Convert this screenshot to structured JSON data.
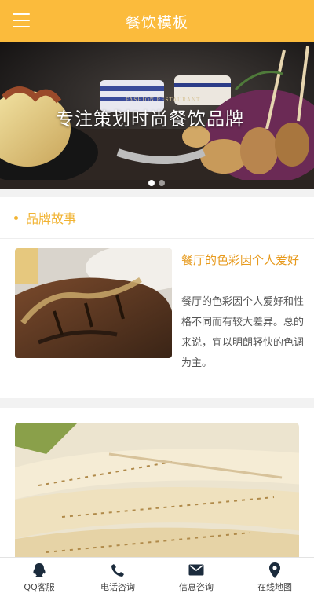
{
  "header": {
    "title": "餐饮模板",
    "menu_icon": "menu-icon"
  },
  "banner": {
    "headline": "专注策划时尚餐饮品牌",
    "subtext": "FASHION RESTAURANT",
    "slide_count": 2,
    "active_slide": 1
  },
  "section": {
    "title": "品牌故事"
  },
  "article": {
    "title": "餐厅的色彩因个人爱好",
    "desc": "餐厅的色彩因个人爱好和性格不同而有较大差异。总的来说，宜以明朗轻快的色调为主。"
  },
  "footer": {
    "items": [
      {
        "label": "QQ客服",
        "icon": "qq-icon"
      },
      {
        "label": "电话咨询",
        "icon": "phone-icon"
      },
      {
        "label": "信息咨询",
        "icon": "mail-icon"
      },
      {
        "label": "在线地图",
        "icon": "map-pin-icon"
      }
    ]
  },
  "colors": {
    "accent": "#fbbb3c",
    "section_title": "#f1b332",
    "article_title": "#e79a1d"
  }
}
